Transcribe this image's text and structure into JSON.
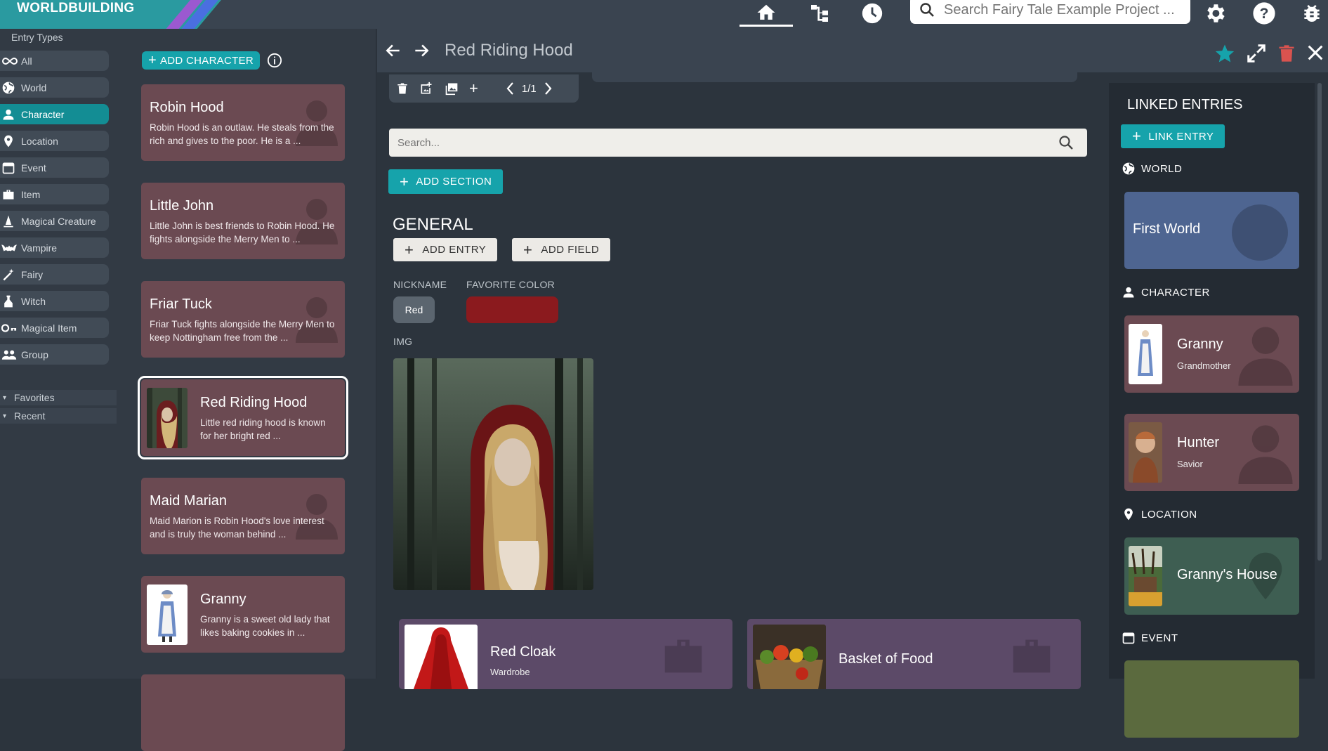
{
  "app": {
    "name": "WORLDBUILDING"
  },
  "topbar": {
    "search_placeholder": "Search Fairy Tale Example Project ...",
    "icons": [
      "home-icon",
      "tree-icon",
      "history-icon",
      "search-icon",
      "gear-icon",
      "help-icon",
      "bug-icon"
    ]
  },
  "sidebar": {
    "header": "Entry Types",
    "items": [
      {
        "label": "All",
        "icon": "infinity-icon"
      },
      {
        "label": "World",
        "icon": "globe-icon"
      },
      {
        "label": "Character",
        "icon": "person-icon",
        "active": true
      },
      {
        "label": "Location",
        "icon": "pin-icon"
      },
      {
        "label": "Event",
        "icon": "calendar-icon"
      },
      {
        "label": "Item",
        "icon": "toolbox-icon"
      },
      {
        "label": "Magical Creature",
        "icon": "wizard-icon"
      },
      {
        "label": "Vampire",
        "icon": "bat-icon"
      },
      {
        "label": "Fairy",
        "icon": "wand-icon"
      },
      {
        "label": "Witch",
        "icon": "potion-icon"
      },
      {
        "label": "Magical Item",
        "icon": "key-icon"
      },
      {
        "label": "Group",
        "icon": "group-icon"
      }
    ],
    "collapsibles": [
      "Favorites",
      "Recent"
    ]
  },
  "list": {
    "add_button": "ADD CHARACTER",
    "cards": [
      {
        "title": "Robin Hood",
        "desc": "Robin Hood is an outlaw. He steals from the rich and gives to the poor. He is a ..."
      },
      {
        "title": "Little John",
        "desc": "Little John is best friends to Robin Hood. He fights alongside the Merry Men to ..."
      },
      {
        "title": "Friar Tuck",
        "desc": "Friar Tuck fights alongside the Merry Men to keep Nottingham free from the ..."
      },
      {
        "title": "Red Riding Hood",
        "desc": "Little red riding hood is known for her bright red ...",
        "selected": true
      },
      {
        "title": "Maid Marian",
        "desc": "Maid Marion is Robin Hood's love interest and is truly the woman behind ..."
      },
      {
        "title": "Granny",
        "desc": "Granny is a sweet old lady that likes baking cookies in ..."
      }
    ]
  },
  "entry": {
    "title": "Red Riding Hood",
    "image_pager": "1/1",
    "search_placeholder": "Search...",
    "add_section": "ADD SECTION",
    "section_title": "GENERAL",
    "add_entry": "ADD ENTRY",
    "add_field": "ADD FIELD",
    "fields": {
      "nickname_label": "NICKNAME",
      "nickname_value": "Red",
      "favorite_color_label": "FAVORITE COLOR",
      "favorite_color_value": "#8b1a1e",
      "img_label": "IMG"
    },
    "items": [
      {
        "title": "Red Cloak",
        "sub": "Wardrobe"
      },
      {
        "title": "Basket of Food",
        "sub": ""
      }
    ]
  },
  "linked": {
    "header": "LINKED ENTRIES",
    "link_button": "LINK ENTRY",
    "groups": {
      "world": "WORLD",
      "character": "CHARACTER",
      "location": "LOCATION",
      "event": "EVENT"
    },
    "world_cards": [
      {
        "title": "First World"
      }
    ],
    "character_cards": [
      {
        "title": "Granny",
        "sub": "Grandmother"
      },
      {
        "title": "Hunter",
        "sub": "Savior"
      }
    ],
    "location_cards": [
      {
        "title": "Granny's House"
      }
    ]
  },
  "colors": {
    "accent": "#16a3ab",
    "character_card": "#6b4a52",
    "item_card": "#5c4a68"
  }
}
